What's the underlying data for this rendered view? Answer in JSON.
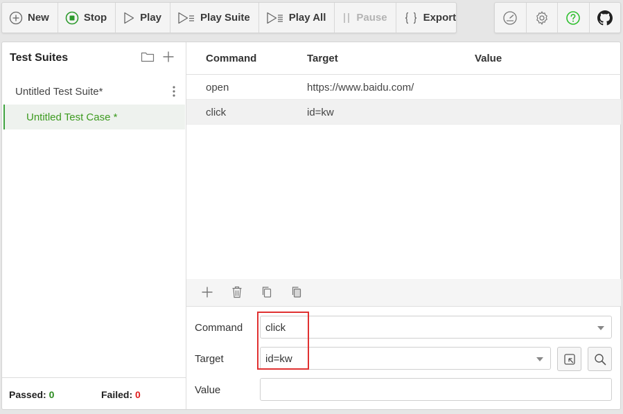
{
  "toolbar": {
    "buttons": [
      {
        "label": "New",
        "icon": "plus-circle-icon"
      },
      {
        "label": "Stop",
        "icon": "stop-icon",
        "color": "#2e9a2e"
      },
      {
        "label": "Play",
        "icon": "play-icon"
      },
      {
        "label": "Play Suite",
        "icon": "play-suite-icon"
      },
      {
        "label": "Play All",
        "icon": "play-all-icon"
      },
      {
        "label": "Pause",
        "icon": "pause-icon",
        "disabled": true
      },
      {
        "label": "Export",
        "icon": "braces-icon"
      }
    ],
    "right_icons": [
      "speed-gauge-icon",
      "gear-icon",
      "help-icon",
      "github-icon"
    ],
    "help_color": "#2fbf2f"
  },
  "sidebar": {
    "title": "Test Suites",
    "suite": {
      "label": "Untitled Test Suite*"
    },
    "case": {
      "label": "Untitled Test Case *"
    },
    "footer": {
      "passed_label": "Passed:",
      "passed_value": "0",
      "failed_label": "Failed:",
      "failed_value": "0"
    }
  },
  "table": {
    "headers": {
      "command": "Command",
      "target": "Target",
      "value": "Value"
    },
    "rows": [
      {
        "command": "open",
        "target": "https://www.baidu.com/",
        "value": ""
      },
      {
        "command": "click",
        "target": "id=kw",
        "value": ""
      }
    ]
  },
  "editor": {
    "command_label": "Command",
    "command_value": "click",
    "target_label": "Target",
    "target_value": "id=kw",
    "value_label": "Value",
    "value_value": ""
  },
  "colors": {
    "accent_green": "#3c9a1f",
    "failed_red": "#e01d1d",
    "highlight_red": "#e03030"
  }
}
